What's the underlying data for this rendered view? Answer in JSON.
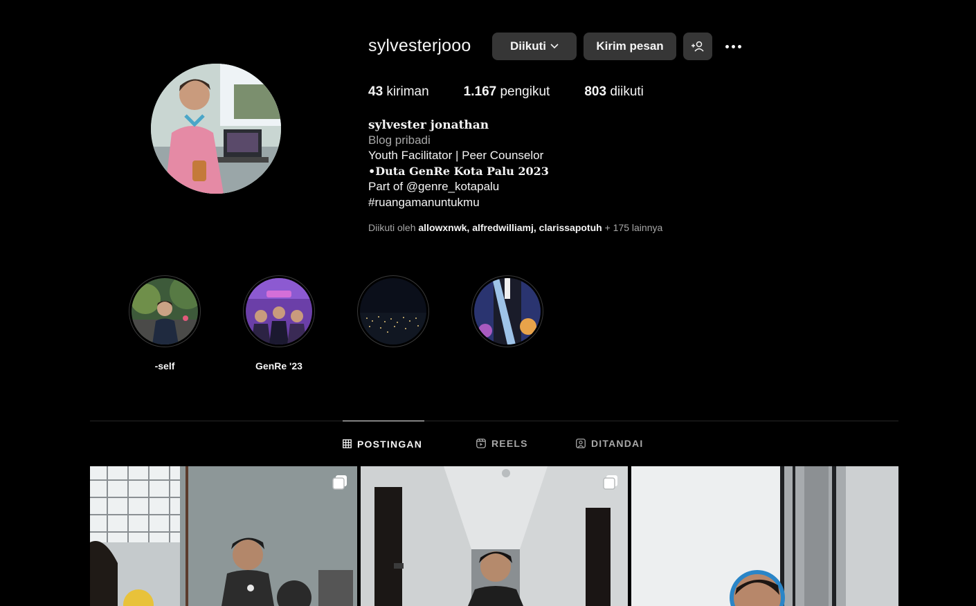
{
  "profile": {
    "username": "sylvesterjooo",
    "buttons": {
      "following": "Diikuti",
      "message": "Kirim pesan"
    },
    "stats": [
      {
        "value": "43",
        "label": "kiriman"
      },
      {
        "value": "1.167",
        "label": "pengikut"
      },
      {
        "value": "803",
        "label": "diikuti"
      }
    ],
    "bio": {
      "name": "sylvester jonathan",
      "category": "Blog pribadi",
      "lines": [
        "Youth Facilitator | Peer Counselor",
        "•Duta GenRe Kota Palu 2023",
        "Part of @genre_kotapalu",
        "#ruangamanuntukmu"
      ]
    },
    "followed_by": {
      "prefix": "Diikuti oleh",
      "users": [
        "allowxnwk",
        "alfredwilliamj",
        "clarissapotuh"
      ],
      "suffix": "+ 175 lainnya"
    }
  },
  "highlights": [
    {
      "label": "-self"
    },
    {
      "label": "GenRe '23"
    },
    {
      "label": ""
    },
    {
      "label": ""
    }
  ],
  "tabs": [
    {
      "label": "POSTINGAN",
      "icon": "grid-icon",
      "active": true
    },
    {
      "label": "REELS",
      "icon": "reels-icon",
      "active": false
    },
    {
      "label": "DITANDAI",
      "icon": "tagged-icon",
      "active": false
    }
  ],
  "posts": [
    {
      "icon": "carousel-icon"
    },
    {
      "icon": "carousel-icon"
    },
    {
      "icon": ""
    }
  ],
  "colors": {
    "background": "#000000",
    "button_bg": "#363636",
    "text": "#f5f5f5",
    "muted": "#a8a8a8",
    "divider": "#262626"
  }
}
